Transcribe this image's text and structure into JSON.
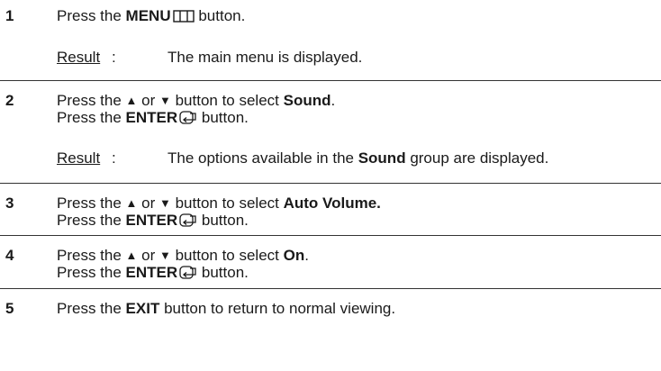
{
  "steps": [
    {
      "number": "1",
      "lines": [
        {
          "pre": "Press the ",
          "bold": "MENU",
          "icon": "menu-icon",
          "post": " button."
        }
      ],
      "result": {
        "label": "Result",
        "colon": ":",
        "pre": "The main menu is displayed.",
        "bold": "",
        "post": ""
      }
    },
    {
      "number": "2",
      "lines": [
        {
          "pre": "Press the ",
          "up": "▲",
          "mid": " or ",
          "down": "▼",
          "post1": " button to select ",
          "bold": "Sound",
          "post": "."
        },
        {
          "pre": "Press the ",
          "bold": "ENTER",
          "icon": "enter-icon",
          "post": " button."
        }
      ],
      "result": {
        "label": "Result",
        "colon": ":",
        "pre": "The options available in the ",
        "bold": "Sound",
        "post": " group are displayed."
      }
    },
    {
      "number": "3",
      "lines": [
        {
          "pre": "Press the ",
          "up": "▲",
          "mid": " or ",
          "down": "▼",
          "post1": " button to select ",
          "bold": "Auto Volume."
        },
        {
          "pre": "Press the ",
          "bold": "ENTER",
          "icon": "enter-icon",
          "post": " button."
        }
      ]
    },
    {
      "number": "4",
      "lines": [
        {
          "pre": "Press the ",
          "up": "▲",
          "mid": " or ",
          "down": "▼",
          "post1": " button to select ",
          "bold": "On",
          "post": "."
        },
        {
          "pre": "Press the ",
          "bold": "ENTER",
          "icon": "enter-icon",
          "post": " button."
        }
      ]
    },
    {
      "number": "5",
      "lines": [
        {
          "pre": "Press the ",
          "bold": "EXIT",
          "post": " button to return to normal viewing."
        }
      ]
    }
  ]
}
